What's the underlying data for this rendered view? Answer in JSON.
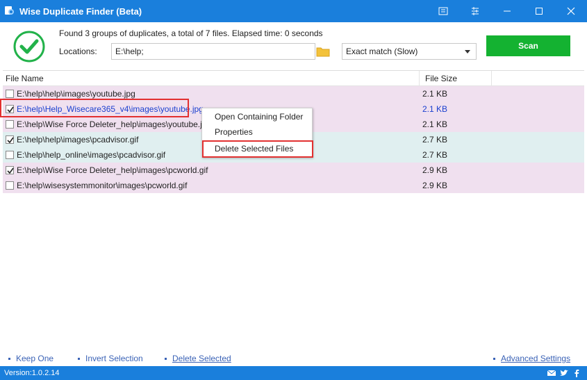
{
  "window": {
    "title": "Wise Duplicate Finder (Beta)"
  },
  "header": {
    "status": "Found 3 groups of duplicates, a total of 7 files. Elapsed time: 0 seconds",
    "locations_label": "Locations:",
    "locations_value": "E:\\help;",
    "match_mode": "Exact match (Slow)",
    "scan_label": "Scan"
  },
  "table": {
    "columns": [
      "File Name",
      "File Size"
    ],
    "rows": [
      {
        "name": "E:\\help\\help\\images\\youtube.jpg",
        "size": "2.1 KB",
        "checked": false,
        "group": 0
      },
      {
        "name": "E:\\help\\Help_Wisecare365_v4\\images\\youtube.jpg",
        "size": "2.1 KB",
        "checked": true,
        "group": 0
      },
      {
        "name": "E:\\help\\Wise Force Deleter_help\\images\\youtube.jpg",
        "size": "2.1 KB",
        "checked": false,
        "group": 0
      },
      {
        "name": "E:\\help\\help\\images\\pcadvisor.gif",
        "size": "2.7 KB",
        "checked": true,
        "group": 1
      },
      {
        "name": "E:\\help\\help_online\\images\\pcadvisor.gif",
        "size": "2.7 KB",
        "checked": false,
        "group": 1
      },
      {
        "name": "E:\\help\\Wise Force Deleter_help\\images\\pcworld.gif",
        "size": "2.9 KB",
        "checked": true,
        "group": 0
      },
      {
        "name": "E:\\help\\wisesystemmonitor\\images\\pcworld.gif",
        "size": "2.9 KB",
        "checked": false,
        "group": 0
      }
    ]
  },
  "context_menu": {
    "items": [
      "Open Containing Folder",
      "Properties",
      "Delete Selected Files"
    ]
  },
  "footer": {
    "keep_one": "Keep One",
    "invert_selection": "Invert Selection",
    "delete_selected": "Delete Selected",
    "advanced_settings": "Advanced Settings"
  },
  "statusbar": {
    "version": "Version:1.0.2.14"
  },
  "colors": {
    "accent": "#1a7fdc",
    "scan": "#14b231",
    "group_pink": "#f0e0ef",
    "group_teal": "#e0eff0",
    "highlight": "#e23030"
  }
}
